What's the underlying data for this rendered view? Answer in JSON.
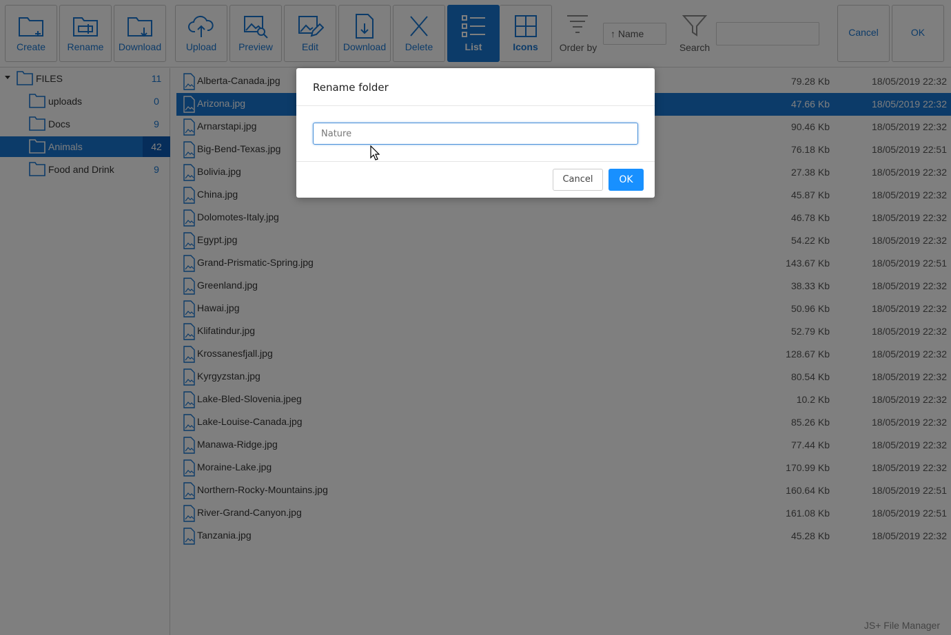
{
  "toolbar": {
    "buttons": [
      {
        "label": "Create",
        "icon": "folder-plus-icon"
      },
      {
        "label": "Rename",
        "icon": "folder-rename-icon"
      },
      {
        "label": "Download",
        "icon": "folder-download-icon"
      },
      {
        "label": "Upload",
        "icon": "cloud-upload-icon"
      },
      {
        "label": "Preview",
        "icon": "image-search-icon"
      },
      {
        "label": "Edit",
        "icon": "image-edit-icon"
      },
      {
        "label": "Download",
        "icon": "file-download-icon"
      },
      {
        "label": "Delete",
        "icon": "close-icon"
      },
      {
        "label": "List",
        "icon": "list-icon"
      },
      {
        "label": "Icons",
        "icon": "grid-icon"
      }
    ],
    "order_by_label": "Order by",
    "order_by_value": "↑ Name",
    "search_label": "Search",
    "search_value": "",
    "cancel_label": "Cancel",
    "ok_label": "OK"
  },
  "sidebar": {
    "root": {
      "label": "FILES",
      "count": "11"
    },
    "folders": [
      {
        "label": "uploads",
        "count": "0"
      },
      {
        "label": "Docs",
        "count": "9"
      },
      {
        "label": "Animals",
        "count": "42"
      },
      {
        "label": "Food and Drink",
        "count": "9"
      }
    ]
  },
  "files": [
    {
      "name": "Alberta-Canada.jpg",
      "size": "79.28 Kb",
      "date": "18/05/2019 22:32"
    },
    {
      "name": "Arizona.jpg",
      "size": "47.66 Kb",
      "date": "18/05/2019 22:32"
    },
    {
      "name": "Arnarstapi.jpg",
      "size": "90.46 Kb",
      "date": "18/05/2019 22:32"
    },
    {
      "name": "Big-Bend-Texas.jpg",
      "size": "76.18 Kb",
      "date": "18/05/2019 22:51"
    },
    {
      "name": "Bolivia.jpg",
      "size": "27.38 Kb",
      "date": "18/05/2019 22:32"
    },
    {
      "name": "China.jpg",
      "size": "45.87 Kb",
      "date": "18/05/2019 22:32"
    },
    {
      "name": "Dolomotes-Italy.jpg",
      "size": "46.78 Kb",
      "date": "18/05/2019 22:32"
    },
    {
      "name": "Egypt.jpg",
      "size": "54.22 Kb",
      "date": "18/05/2019 22:32"
    },
    {
      "name": "Grand-Prismatic-Spring.jpg",
      "size": "143.67 Kb",
      "date": "18/05/2019 22:51"
    },
    {
      "name": "Greenland.jpg",
      "size": "38.33 Kb",
      "date": "18/05/2019 22:32"
    },
    {
      "name": "Hawai.jpg",
      "size": "50.96 Kb",
      "date": "18/05/2019 22:32"
    },
    {
      "name": "Klifatindur.jpg",
      "size": "52.79 Kb",
      "date": "18/05/2019 22:32"
    },
    {
      "name": "Krossanesfjall.jpg",
      "size": "128.67 Kb",
      "date": "18/05/2019 22:32"
    },
    {
      "name": "Kyrgyzstan.jpg",
      "size": "80.54 Kb",
      "date": "18/05/2019 22:32"
    },
    {
      "name": "Lake-Bled-Slovenia.jpeg",
      "size": "10.2 Kb",
      "date": "18/05/2019 22:32"
    },
    {
      "name": "Lake-Louise-Canada.jpg",
      "size": "85.26 Kb",
      "date": "18/05/2019 22:32"
    },
    {
      "name": "Manawa-Ridge.jpg",
      "size": "77.44 Kb",
      "date": "18/05/2019 22:32"
    },
    {
      "name": "Moraine-Lake.jpg",
      "size": "170.99 Kb",
      "date": "18/05/2019 22:32"
    },
    {
      "name": "Northern-Rocky-Mountains.jpg",
      "size": "160.64 Kb",
      "date": "18/05/2019 22:51"
    },
    {
      "name": "River-Grand-Canyon.jpg",
      "size": "161.08 Kb",
      "date": "18/05/2019 22:51"
    },
    {
      "name": "Tanzania.jpg",
      "size": "45.28 Kb",
      "date": "18/05/2019 22:32"
    }
  ],
  "footer": "JS+ File Manager",
  "modal": {
    "title": "Rename folder",
    "input_value": "Nature",
    "cancel_label": "Cancel",
    "ok_label": "OK"
  },
  "colors": {
    "accent": "#1976d2",
    "ok_button": "#1890ff"
  }
}
